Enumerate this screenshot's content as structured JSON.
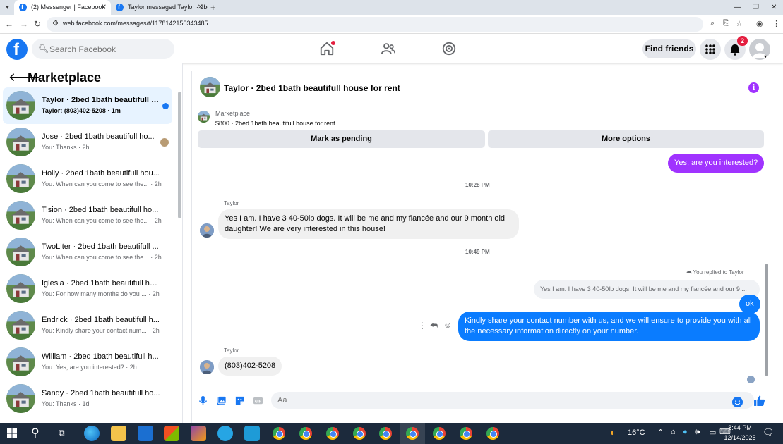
{
  "browser": {
    "tabs": [
      {
        "title": "(2) Messenger | Facebook"
      },
      {
        "title": "Taylor messaged Taylor · 2bed 1"
      }
    ],
    "url": "web.facebook.com/messages/t/1178142150343485"
  },
  "header": {
    "search_placeholder": "Search Facebook",
    "find_friends": "Find friends",
    "notification_count": "2"
  },
  "sidebar": {
    "title": "Marketplace",
    "conversations": [
      {
        "name": "Taylor · 2bed 1bath beautifull h...",
        "preview": "Taylor: (803)402-5208 · 1m"
      },
      {
        "name": "Jose · 2bed 1bath beautifull ho...",
        "preview": "You: Thanks · 2h"
      },
      {
        "name": "Holly · 2bed 1bath beautifull hou...",
        "preview": "You: When can you come to see the... · 2h"
      },
      {
        "name": "Tision · 2bed 1bath beautifull ho...",
        "preview": "You: When can you come to see the... · 2h"
      },
      {
        "name": "TwoLiter · 2bed 1bath beautifull ...",
        "preview": "You: When can you come to see the... · 2h"
      },
      {
        "name": "Iglesia · 2bed 1bath beautifull ho...",
        "preview": "You: For how many months do you ... · 2h"
      },
      {
        "name": "Endrick · 2bed 1bath beautifull h...",
        "preview": "You: Kindly share your contact num... · 2h"
      },
      {
        "name": "William · 2bed 1bath beautifull h...",
        "preview": "You: Yes, are you interested? · 2h"
      },
      {
        "name": "Sandy · 2bed 1bath beautifull ho...",
        "preview": "You: Thanks · 1d"
      }
    ]
  },
  "chat": {
    "title": "Taylor · 2bed 1bath beautifull house for rent",
    "marketplace_label": "Marketplace",
    "listing": "$800 · 2bed 1bath beautifull house for rent",
    "mark_pending": "Mark as pending",
    "more_options": "More options",
    "messages": {
      "out_interested": "Yes, are you interested?",
      "time_1": "10:28 PM",
      "sender_1": "Taylor",
      "in_dogs": "Yes I am. I have 3 40-50lb dogs. It will be me and my fiancée and our 9 month old daughter! We are very interested in this house!",
      "time_2": "10:49 PM",
      "replied_to": "You replied to Taylor",
      "quoted": "Yes I am. I have 3 40-50lb dogs. It will be me and my fiancée and our 9 ...",
      "out_ok": "ok",
      "out_contact": "Kindly share your contact number with us, and we will ensure to provide you with all the necessary information directly on your number.",
      "sender_2": "Taylor",
      "in_phone": "(803)402-5208"
    },
    "composer_placeholder": "Aa"
  },
  "taskbar": {
    "temperature": "16°C",
    "time": "8:44 PM",
    "date": "12/14/2025"
  },
  "colors": {
    "facebook_blue": "#1877f2",
    "messenger_purple": "#a033ff",
    "out_bubble": "#0a7cff"
  }
}
